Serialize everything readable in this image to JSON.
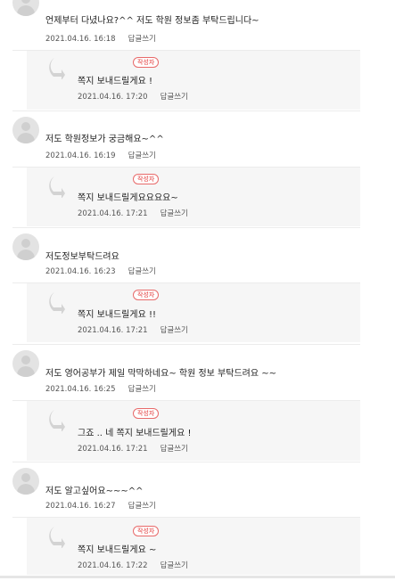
{
  "comments": [
    {
      "text": "언제부터 다녔나요?^^ 저도 학원 정보좀 부탁드립니다~",
      "date": "2021.04.16. 16:18",
      "reply_label": "답글쓰기",
      "reply": {
        "badge": "작성자",
        "text": "쪽지 보내드릴게요 !",
        "date": "2021.04.16. 17:20",
        "reply_label": "답글쓰기"
      }
    },
    {
      "text": "저도 학원정보가 궁금해요~^^",
      "date": "2021.04.16. 16:19",
      "reply_label": "답글쓰기",
      "reply": {
        "badge": "작성자",
        "text": "쪽지 보내드릴게요요요요~",
        "date": "2021.04.16. 17:21",
        "reply_label": "답글쓰기"
      }
    },
    {
      "text": "저도정보부탁드려요",
      "date": "2021.04.16. 16:23",
      "reply_label": "답글쓰기",
      "reply": {
        "badge": "작성자",
        "text": "쪽지 보내드릴게요 !!",
        "date": "2021.04.16. 17:21",
        "reply_label": "답글쓰기"
      }
    },
    {
      "text": "저도 영어공부가 제일 막막하네요~ 학원 정보 부탁드려요 ~~",
      "date": "2021.04.16. 16:25",
      "reply_label": "답글쓰기",
      "reply": {
        "badge": "작성자",
        "text": "그죠 .. 네 쪽지 보내드릴게요 !",
        "date": "2021.04.16. 17:21",
        "reply_label": "답글쓰기"
      }
    },
    {
      "text": "저도 알고싶어요~~~^^",
      "date": "2021.04.16. 16:27",
      "reply_label": "답글쓰기",
      "reply": {
        "badge": "작성자",
        "text": "쪽지 보내드릴게요 ~",
        "date": "2021.04.16. 17:22",
        "reply_label": "답글쓰기"
      }
    }
  ],
  "colors": {
    "badge": "#e23a3a",
    "reply_bg": "#f6f6f6",
    "separator": "#ececec"
  }
}
